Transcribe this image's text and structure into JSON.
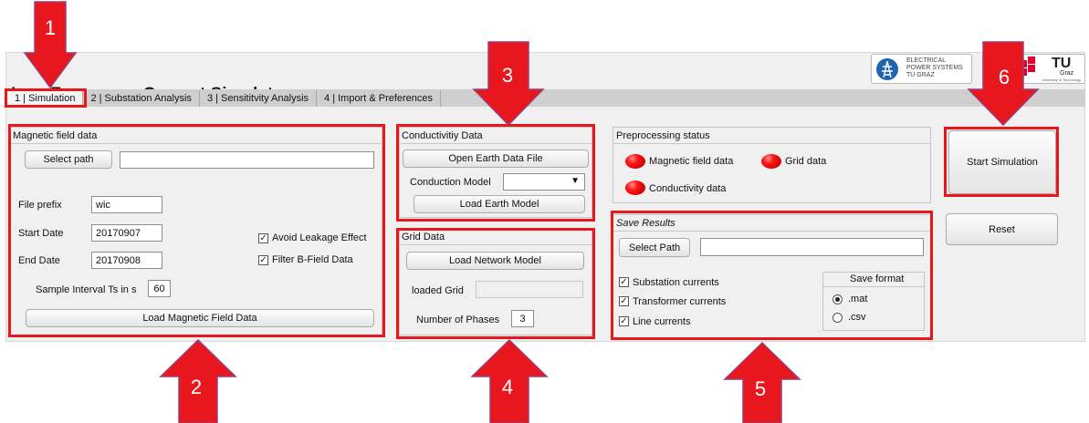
{
  "app": {
    "title": "Low Frequency Current Simulator",
    "logos": {
      "eps_lines": [
        "ELECTRICAL",
        "POWER SYSTEMS",
        "TU GRAZ"
      ],
      "tu_mark": "TU",
      "tu_graz": "Graz",
      "tu_sub": "University of Technology"
    }
  },
  "tabs": [
    {
      "label": "1 | Simulation"
    },
    {
      "label": "2 | Substation Analysis"
    },
    {
      "label": "3 | Sensititvity Analysis"
    },
    {
      "label": "4 | Import & Preferences"
    }
  ],
  "magnetic": {
    "title": "Magnetic field data",
    "select_path": "Select path",
    "path_value": "",
    "file_prefix_label": "File prefix",
    "file_prefix": "wic",
    "start_label": "Start Date",
    "start_value": "20170907",
    "end_label": "End Date",
    "end_value": "20170908",
    "avoid_leakage": "Avoid Leakage Effect",
    "filter_b": "Filter B-Field Data",
    "sample_label": "Sample Interval Ts in s",
    "sample_value": "60",
    "load_btn": "Load Magnetic Field Data"
  },
  "conductivity": {
    "title": "Conductivitiy Data",
    "open_btn": "Open Earth Data File",
    "model_label": "Conduction Model",
    "model_value": "",
    "load_btn": "Load Earth Model"
  },
  "grid": {
    "title": "Grid Data",
    "load_btn": "Load Network Model",
    "loaded_label": "loaded Grid",
    "loaded_value": "",
    "phases_label": "Number of Phases",
    "phases_value": "3"
  },
  "preprocessing": {
    "title": "Preprocessing status",
    "items": [
      "Magnetic field data",
      "Grid data",
      "Conductivity data"
    ],
    "led_color": "#e8171e"
  },
  "save": {
    "title": "Save Results",
    "select_path": "Select Path",
    "path_value": "",
    "substation": "Substation currents",
    "transformer": "Transformer currents",
    "line": "Line currents",
    "format_title": "Save format",
    "formats": [
      ".mat",
      ".csv"
    ],
    "selected_format": ".mat"
  },
  "actions": {
    "start": "Start Simulation",
    "reset": "Reset"
  },
  "annotations": {
    "color": "#e8171e",
    "numbers": [
      "1",
      "2",
      "3",
      "4",
      "5",
      "6"
    ]
  }
}
